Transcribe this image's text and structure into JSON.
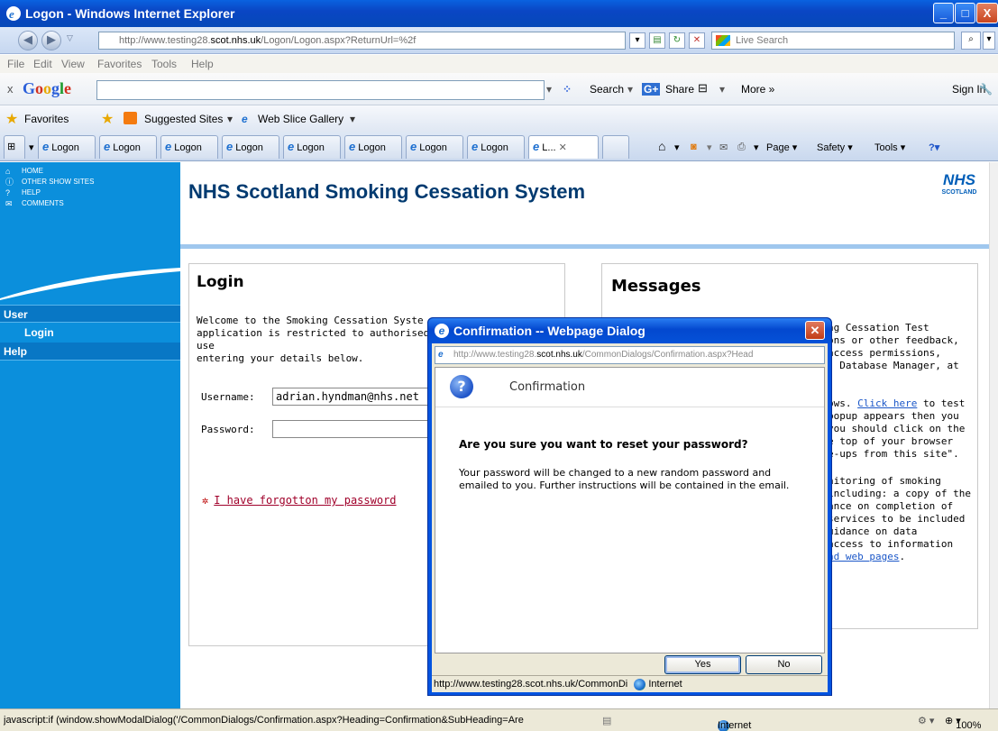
{
  "window": {
    "title": "Logon - Windows Internet Explorer"
  },
  "address": {
    "url_prefix": "http://www.testing28.",
    "url_host": "scot.nhs.uk",
    "url_suffix": "/Logon/Logon.aspx?ReturnUrl=%2f",
    "search_placeholder": "Live Search"
  },
  "menu": [
    "File",
    "Edit",
    "View",
    "Favorites",
    "Tools",
    "Help"
  ],
  "googlebar": {
    "close": "x",
    "logo": "Google",
    "search_label": "Search",
    "share_label": "Share",
    "more_label": "More »",
    "signin_label": "Sign In"
  },
  "favorites": {
    "favorites_label": "Favorites",
    "suggested_sites": "Suggested Sites",
    "web_slice_gallery": "Web Slice Gallery"
  },
  "tabs": [
    "Logon",
    "Logon",
    "Logon",
    "Logon",
    "Logon",
    "Logon",
    "Logon",
    "Logon",
    "L..."
  ],
  "command_bar": {
    "page_label": "Page",
    "safety_label": "Safety",
    "tools_label": "Tools"
  },
  "site": {
    "top_links": [
      "HOME",
      "OTHER SHOW SITES",
      "HELP",
      "COMMENTS"
    ],
    "title": "NHS Scotland Smoking Cessation System",
    "logo_main": "NHS",
    "logo_sub": "SCOTLAND",
    "nav": {
      "user_header": "User",
      "login_item": "Login",
      "help_header": "Help"
    }
  },
  "login": {
    "heading": "Login",
    "welcome": "Welcome to the Smoking Cessation Syste\napplication is restricted to authorised use\nentering your details below.",
    "username_label": "Username:",
    "username_value": "adrian.hyndman@nhs.net",
    "password_label": "Password:",
    "forgot_link": "I have forgotton my password"
  },
  "messages": {
    "heading": "Messages",
    "lines": [
      "ng Cessation Test",
      "ons or other feedback,",
      "access permissions,",
      ". Database Manager, at",
      "",
      "ows.",
      "popup appears then you",
      "you should click on the",
      "e top of your browser",
      "e-ups from this site\".",
      "",
      "nitoring of smoking",
      "including: a copy of the",
      "ance on completion of",
      " services to be included",
      "uidance on data",
      "access to information"
    ],
    "click_here": "Click here",
    "click_here_tail": " to test",
    "web_pages_link": "nd web pages",
    "web_pages_tail": "."
  },
  "dialog": {
    "title": "Confirmation -- Webpage Dialog",
    "url_prefix": "http://www.testing28.",
    "url_host": "scot.nhs.uk",
    "url_suffix": "/CommonDialogs/Confirmation.aspx?Head",
    "heading": "Confirmation",
    "question": "Are you sure you want to reset your password?",
    "body": "Your password will be changed to a new random password and emailed to you. Further instructions will be contained in the email.",
    "yes_label": "Yes",
    "no_label": "No",
    "status_url": "http://www.testing28.scot.nhs.uk/CommonDi",
    "status_zone": "Internet"
  },
  "statusbar": {
    "text": "javascript:if (window.showModalDialog('/CommonDialogs/Confirmation.aspx?Heading=Confirmation&SubHeading=Are",
    "zone": "Internet",
    "zoom": "100%"
  },
  "colors": {
    "nav_blue": "#0b8fdc",
    "title_blue": "#003a70",
    "xp_titlebar": "#0548b8",
    "link_red": "#a0002a"
  }
}
